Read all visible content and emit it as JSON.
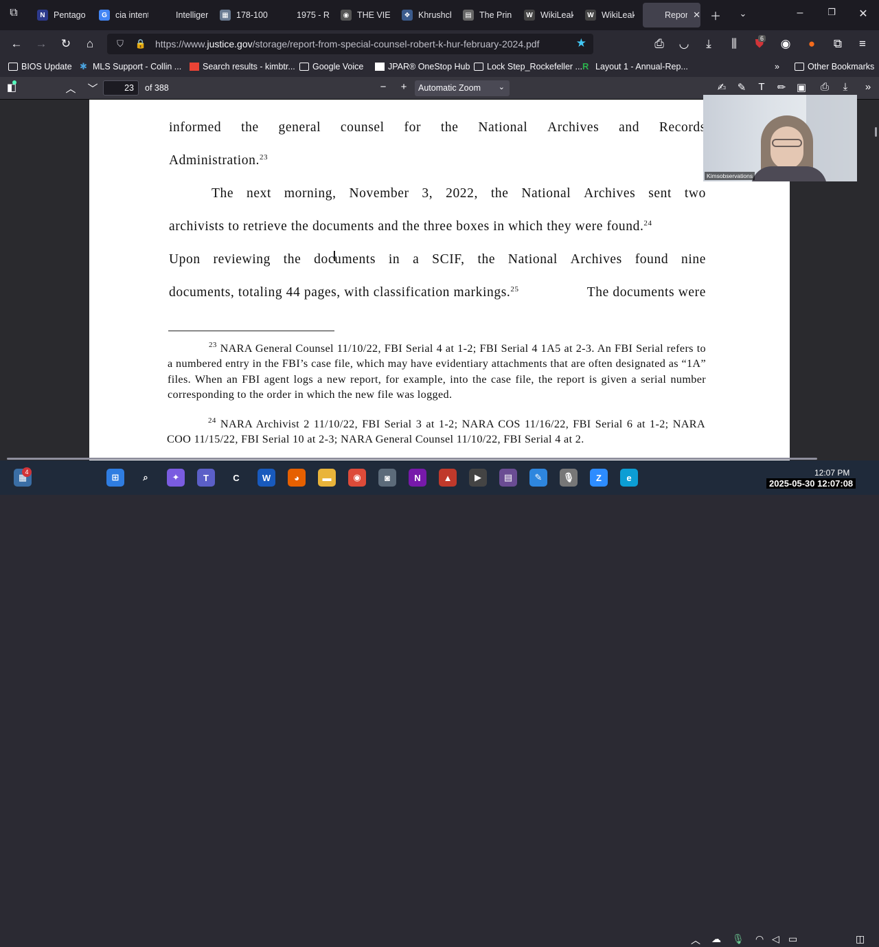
{
  "tabs": [
    {
      "title": "Pentago",
      "favicon": "N",
      "color": "#2d3a8c"
    },
    {
      "title": "cia intent",
      "favicon": "G",
      "color": "#4285f4"
    },
    {
      "title": "Intelliger",
      "favicon": "",
      "color": "#1c1b22"
    },
    {
      "title": "178-100",
      "favicon": "▦",
      "color": "#6b7c93"
    },
    {
      "title": "1975 - R",
      "favicon": "",
      "color": "#1c1b22"
    },
    {
      "title": "THE VIET",
      "favicon": "◉",
      "color": "#555"
    },
    {
      "title": "Khrushch",
      "favicon": "❖",
      "color": "#3b5b8c"
    },
    {
      "title": "The Prin",
      "favicon": "▤",
      "color": "#666"
    },
    {
      "title": "WikiLeak",
      "favicon": "W",
      "color": "#444"
    },
    {
      "title": "WikiLeak",
      "favicon": "W",
      "color": "#444"
    },
    {
      "title": "Repor",
      "favicon": "",
      "color": "#42414d"
    }
  ],
  "url": {
    "prefix": "https://www.",
    "domain": "justice.gov",
    "path": "/storage/report-from-special-counsel-robert-k-hur-february-2024.pdf"
  },
  "toolbar_badge": "6",
  "bookmarks": [
    {
      "label": "BIOS Update",
      "icon": "folder-icon"
    },
    {
      "label": "MLS Support - Collin ...",
      "icon": "mls-icon"
    },
    {
      "label": "Search results - kimbtr...",
      "icon": "gmail-icon"
    },
    {
      "label": "Google Voice",
      "icon": "folder-icon"
    },
    {
      "label": "JPAR® OneStop Hub",
      "icon": "doc-icon"
    },
    {
      "label": "Lock Step_Rockefeller ...",
      "icon": "folder-icon"
    },
    {
      "label": "Layout 1 - Annual-Rep...",
      "icon": "r-icon"
    }
  ],
  "other_bookmarks": "Other Bookmarks",
  "pdf": {
    "page": "23",
    "of_pages": "of 388",
    "zoom": "Automatic Zoom"
  },
  "document": {
    "line1": [
      "informed",
      "the",
      "general",
      "counsel",
      "for",
      "the",
      "National",
      "Archives",
      "and",
      "Records"
    ],
    "line2": "Administration.",
    "fn23_ref": "23",
    "line3": [
      "The",
      "next",
      "morning,",
      "November",
      "3,",
      "2022,",
      "the",
      "National",
      "Archives",
      "sent",
      "two"
    ],
    "line4": "archivists to retrieve the documents and the three boxes in which they were found.",
    "fn24_ref": "24",
    "line5": [
      "Upon",
      "reviewing",
      "the",
      "documents",
      "in",
      "a",
      "SCIF,",
      "the",
      "National",
      "Archives",
      "found",
      "nine"
    ],
    "line6a": "documents, totaling 44 pages, with classification markings.",
    "fn25_ref": "25",
    "line6b": "The documents were",
    "footnote23_num": "23",
    "footnote23": "NARA General Counsel 11/10/22, FBI Serial 4 at 1-2; FBI Serial 4 1A5 at 2-3.  An FBI Serial refers to a numbered entry in the FBI’s case file, which may have evidentiary attachments that are often designated as “1A” files. When an FBI agent logs a new report, for example, into the case file, the report is given a serial number corresponding to the order in which the new file was logged.",
    "footnote24_num": "24",
    "footnote24": "NARA Archivist 2 11/10/22, FBI Serial 3 at 1-2; NARA COS 11/16/22, FBI Serial 6 at 1-2; NARA COO 11/15/22, FBI Serial 10 at 2-3; NARA General Counsel 11/10/22, FBI Serial 4 at 2."
  },
  "video_name": "Kimsobservations",
  "taskbar": {
    "badge": "4",
    "time": "12:07 PM",
    "date": "2025-05-30 12:07:08",
    "apps": [
      {
        "name": "start-icon",
        "color": "#2f7de1",
        "glyph": "⊞"
      },
      {
        "name": "search-icon",
        "color": "transparent",
        "glyph": "⌕"
      },
      {
        "name": "copilot-icon",
        "color": "#7a5ce0",
        "glyph": "✦"
      },
      {
        "name": "teams-icon",
        "color": "#5b5fc7",
        "glyph": "T"
      },
      {
        "name": "app-icon",
        "color": "transparent",
        "glyph": "C"
      },
      {
        "name": "word-icon",
        "color": "#185abd",
        "glyph": "W"
      },
      {
        "name": "firefox-icon",
        "color": "#e66000",
        "glyph": "◕"
      },
      {
        "name": "explorer-icon",
        "color": "#e9b43a",
        "glyph": "▬"
      },
      {
        "name": "chrome-icon",
        "color": "#dd4b39",
        "glyph": "◉"
      },
      {
        "name": "camera-icon",
        "color": "#5c6b7a",
        "glyph": "◙"
      },
      {
        "name": "onenote-icon",
        "color": "#7719aa",
        "glyph": "N"
      },
      {
        "name": "app2-icon",
        "color": "#c0392b",
        "glyph": "▲"
      },
      {
        "name": "media-icon",
        "color": "#444",
        "glyph": "▶"
      },
      {
        "name": "clapper-icon",
        "color": "#6a4c93",
        "glyph": "▤"
      },
      {
        "name": "paint-icon",
        "color": "#2e86de",
        "glyph": "✎"
      },
      {
        "name": "mic-icon",
        "color": "#777",
        "glyph": "🎙"
      },
      {
        "name": "zoom-icon",
        "color": "#2d8cff",
        "glyph": "Z"
      },
      {
        "name": "edge-icon",
        "color": "#0c9ed4",
        "glyph": "e"
      }
    ]
  }
}
